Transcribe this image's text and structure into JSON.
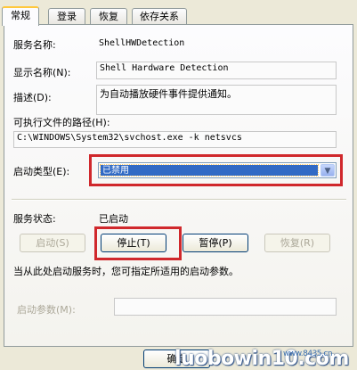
{
  "tabs": [
    "常规",
    "登录",
    "恢复",
    "依存关系"
  ],
  "service_name": {
    "label": "服务名称:",
    "value": "ShellHWDetection"
  },
  "display_name": {
    "label": "显示名称(N):",
    "value": "Shell Hardware Detection"
  },
  "description": {
    "label": "描述(D):",
    "value": "为自动播放硬件事件提供通知。"
  },
  "exe_path": {
    "label": "可执行文件的路径(H):",
    "value": "C:\\WINDOWS\\System32\\svchost.exe -k netsvcs"
  },
  "startup_type": {
    "label": "启动类型(E):",
    "value": "已禁用"
  },
  "service_status": {
    "label": "服务状态:",
    "value": "已启动"
  },
  "buttons": {
    "start": "启动(S)",
    "stop": "停止(T)",
    "pause": "暂停(P)",
    "resume": "恢复(R)"
  },
  "hint": "当从此处启动服务时，您可指定所适用的启动参数。",
  "start_params": {
    "label": "启动参数(M):",
    "value": ""
  },
  "ok_button": "确定",
  "watermark": {
    "brand": "luobowin10.com",
    "url": "www.8435.cn"
  },
  "colors": {
    "highlight": "#316ac5",
    "annotation": "#d0282c"
  }
}
